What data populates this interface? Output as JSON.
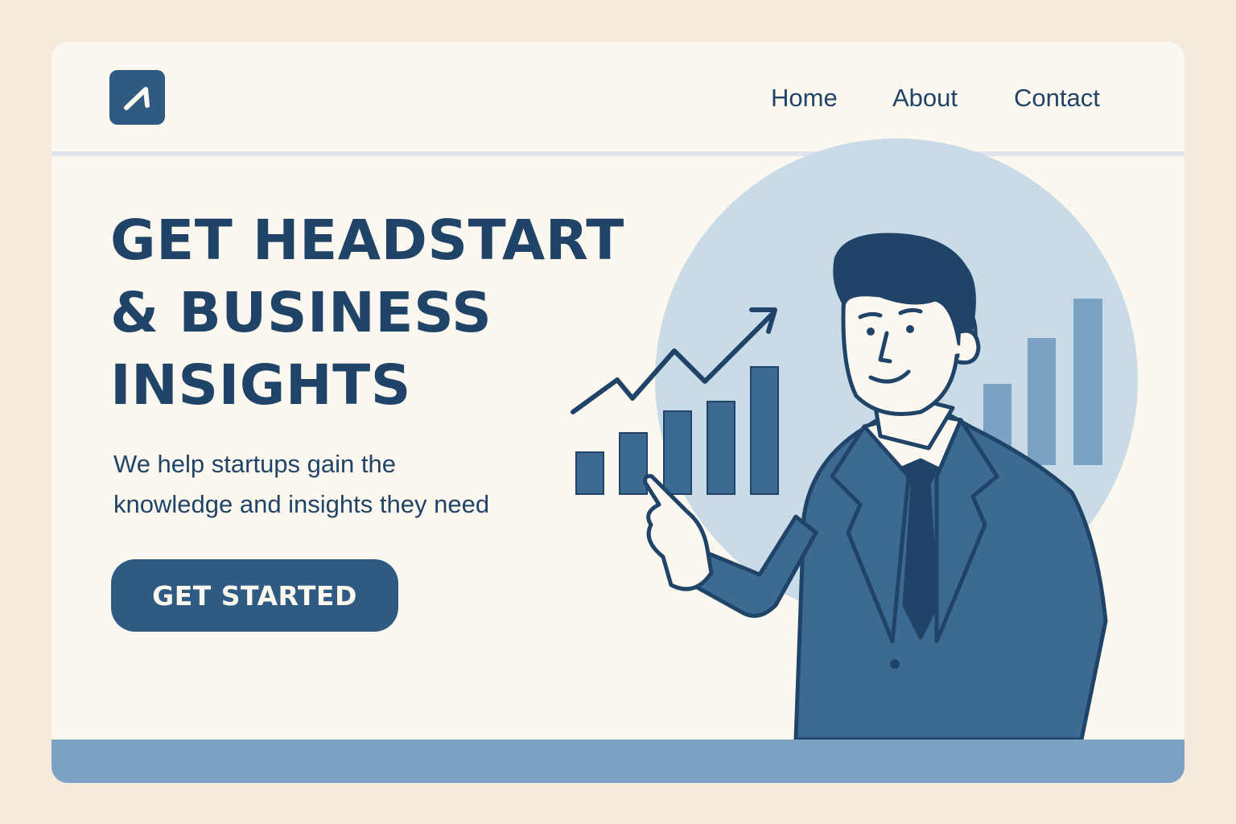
{
  "nav": {
    "home": "Home",
    "about": "About",
    "contact": "Contact"
  },
  "hero": {
    "headline": [
      "GET HEADSTART",
      "& BUSINESS",
      "INSIGHTS"
    ],
    "subtext": [
      "We help startups gain the",
      "knowledge and insights they need"
    ],
    "cta_label": "GET STARTED"
  },
  "icons": {
    "logo": "arrow-up-right-logo-icon",
    "trend": "trend-arrow-icon"
  },
  "colors": {
    "primary": "#2f5b82",
    "text": "#1f4468",
    "background": "#fcf8ef",
    "accent_light": "#c9dbe7",
    "accent_mid": "#7ba2c2"
  }
}
